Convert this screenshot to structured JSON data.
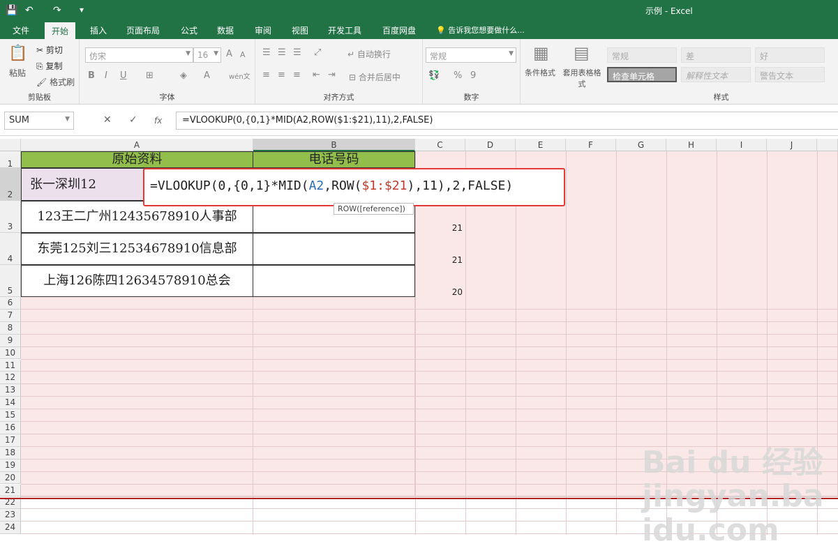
{
  "window": {
    "title": "示例 - Excel"
  },
  "quick_access": {
    "save_icon": "save-icon",
    "undo_icon": "undo-icon",
    "redo_icon": "redo-icon"
  },
  "tabs": [
    {
      "label": "文件"
    },
    {
      "label": "开始"
    },
    {
      "label": "插入"
    },
    {
      "label": "页面布局"
    },
    {
      "label": "公式"
    },
    {
      "label": "数据"
    },
    {
      "label": "审阅"
    },
    {
      "label": "视图"
    },
    {
      "label": "开发工具"
    },
    {
      "label": "百度网盘"
    }
  ],
  "tell_me": "告诉我您想要做什么...",
  "ribbon": {
    "clipboard": {
      "paste": "粘贴",
      "cut": "剪切",
      "copy": "复制",
      "format_painter": "格式刷",
      "label": "剪贴板"
    },
    "font": {
      "font_name": "仿宋",
      "font_size": "16",
      "label": "字体",
      "bold": "B",
      "italic": "I",
      "underline": "U",
      "grow": "A",
      "shrink": "A",
      "color": "A",
      "wen": "wén文"
    },
    "alignment": {
      "wrap_text": "自动换行",
      "merge_center": "合并后居中",
      "label": "对齐方式"
    },
    "number": {
      "format": "常规",
      "percent": "%",
      "comma": "9",
      "label": "数字"
    },
    "styles": {
      "conditional": "条件格式",
      "table_format": "套用表格格式",
      "label": "样式",
      "cells": [
        "常规",
        "差",
        "好",
        "检查单元格",
        "解释性文本",
        "警告文本"
      ]
    }
  },
  "formula_bar": {
    "name_box": "SUM",
    "formula": "=VLOOKUP(0,{0,1}*MID(A2,ROW($1:$21),11),2,FALSE)",
    "fx": "fx"
  },
  "sheet": {
    "columns": [
      "A",
      "B",
      "C",
      "D",
      "E",
      "F",
      "G",
      "H",
      "I",
      "J"
    ],
    "rows": [
      "1",
      "2",
      "3",
      "4",
      "5",
      "6",
      "7",
      "8",
      "9",
      "10",
      "11",
      "12",
      "13",
      "14",
      "15",
      "16",
      "17",
      "18",
      "19",
      "20",
      "21",
      "22",
      "23",
      "24"
    ],
    "header_a": "原始资料",
    "header_b": "电话号码",
    "data": [
      {
        "a": "张一深圳12",
        "c": ""
      },
      {
        "a": "123王二广州12435678910人事部",
        "c": "21"
      },
      {
        "a": "东莞125刘三12534678910信息部",
        "c": "21"
      },
      {
        "a": "上海126陈四12634578910总会",
        "c": "20"
      }
    ]
  },
  "edit_popup": {
    "p1": "=VLOOKUP(0,{0,1}*MID(",
    "p2": "A2",
    "p3": ",ROW(",
    "p4": "$1:$21",
    "p5": "),11),2,FALSE)"
  },
  "tooltip": "ROW([reference])",
  "watermark": "Bai du 经验 jingyan.baidu.com"
}
